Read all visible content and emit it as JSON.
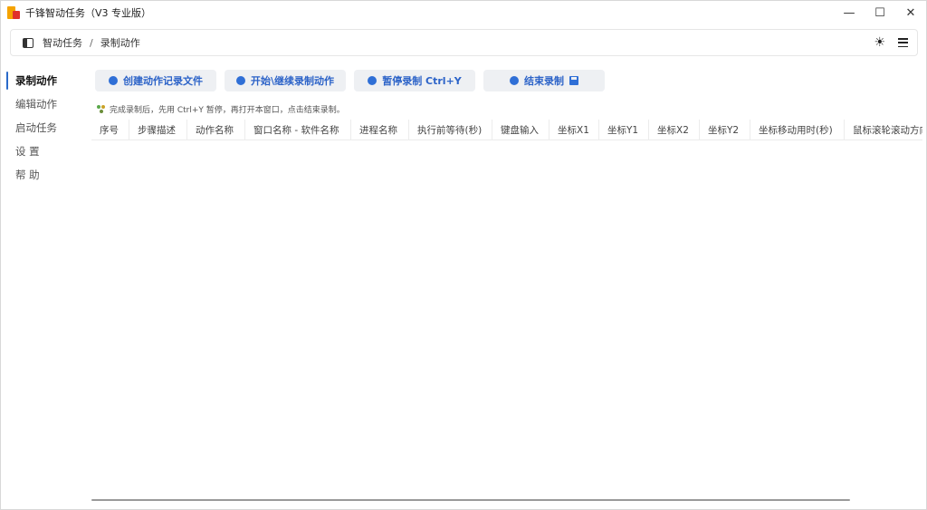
{
  "window": {
    "title": "千锋智动任务（V3 专业版）",
    "controls": {
      "minimize": "—",
      "maximize": "☐",
      "close": "✕"
    }
  },
  "header": {
    "breadcrumb": [
      "智动任务",
      "录制动作"
    ],
    "separator": "/",
    "icons": [
      "sidebar-toggle-icon",
      "sun-icon",
      "menu-icon"
    ]
  },
  "sidebar": {
    "items": [
      {
        "label": "录制动作",
        "active": true
      },
      {
        "label": "编辑动作",
        "active": false
      },
      {
        "label": "启动任务",
        "active": false
      },
      {
        "label": "设 置",
        "active": false
      },
      {
        "label": "帮 助",
        "active": false
      }
    ]
  },
  "toolbar": {
    "create_label": "创建动作记录文件",
    "start_label": "开始\\继续录制动作",
    "pause_label": "暂停录制 Ctrl+Y",
    "end_label": "结束录制"
  },
  "hint": "完成录制后，先用 Ctrl+Y 暂停，再打开本窗口，点击结束录制。",
  "table": {
    "columns": [
      "序号",
      "步骤描述",
      "动作名称",
      "窗口名称 - 软件名称",
      "进程名称",
      "执行前等待(秒)",
      "键盘输入",
      "坐标X1",
      "坐标Y1",
      "坐标X2",
      "坐标Y2",
      "坐标移动用时(秒)",
      "鼠标滚轮滚动方向"
    ],
    "rows": []
  },
  "colors": {
    "accent": "#2c63c8",
    "button_bg": "#eef0f3",
    "active_indicator": "#2a6ac9"
  }
}
